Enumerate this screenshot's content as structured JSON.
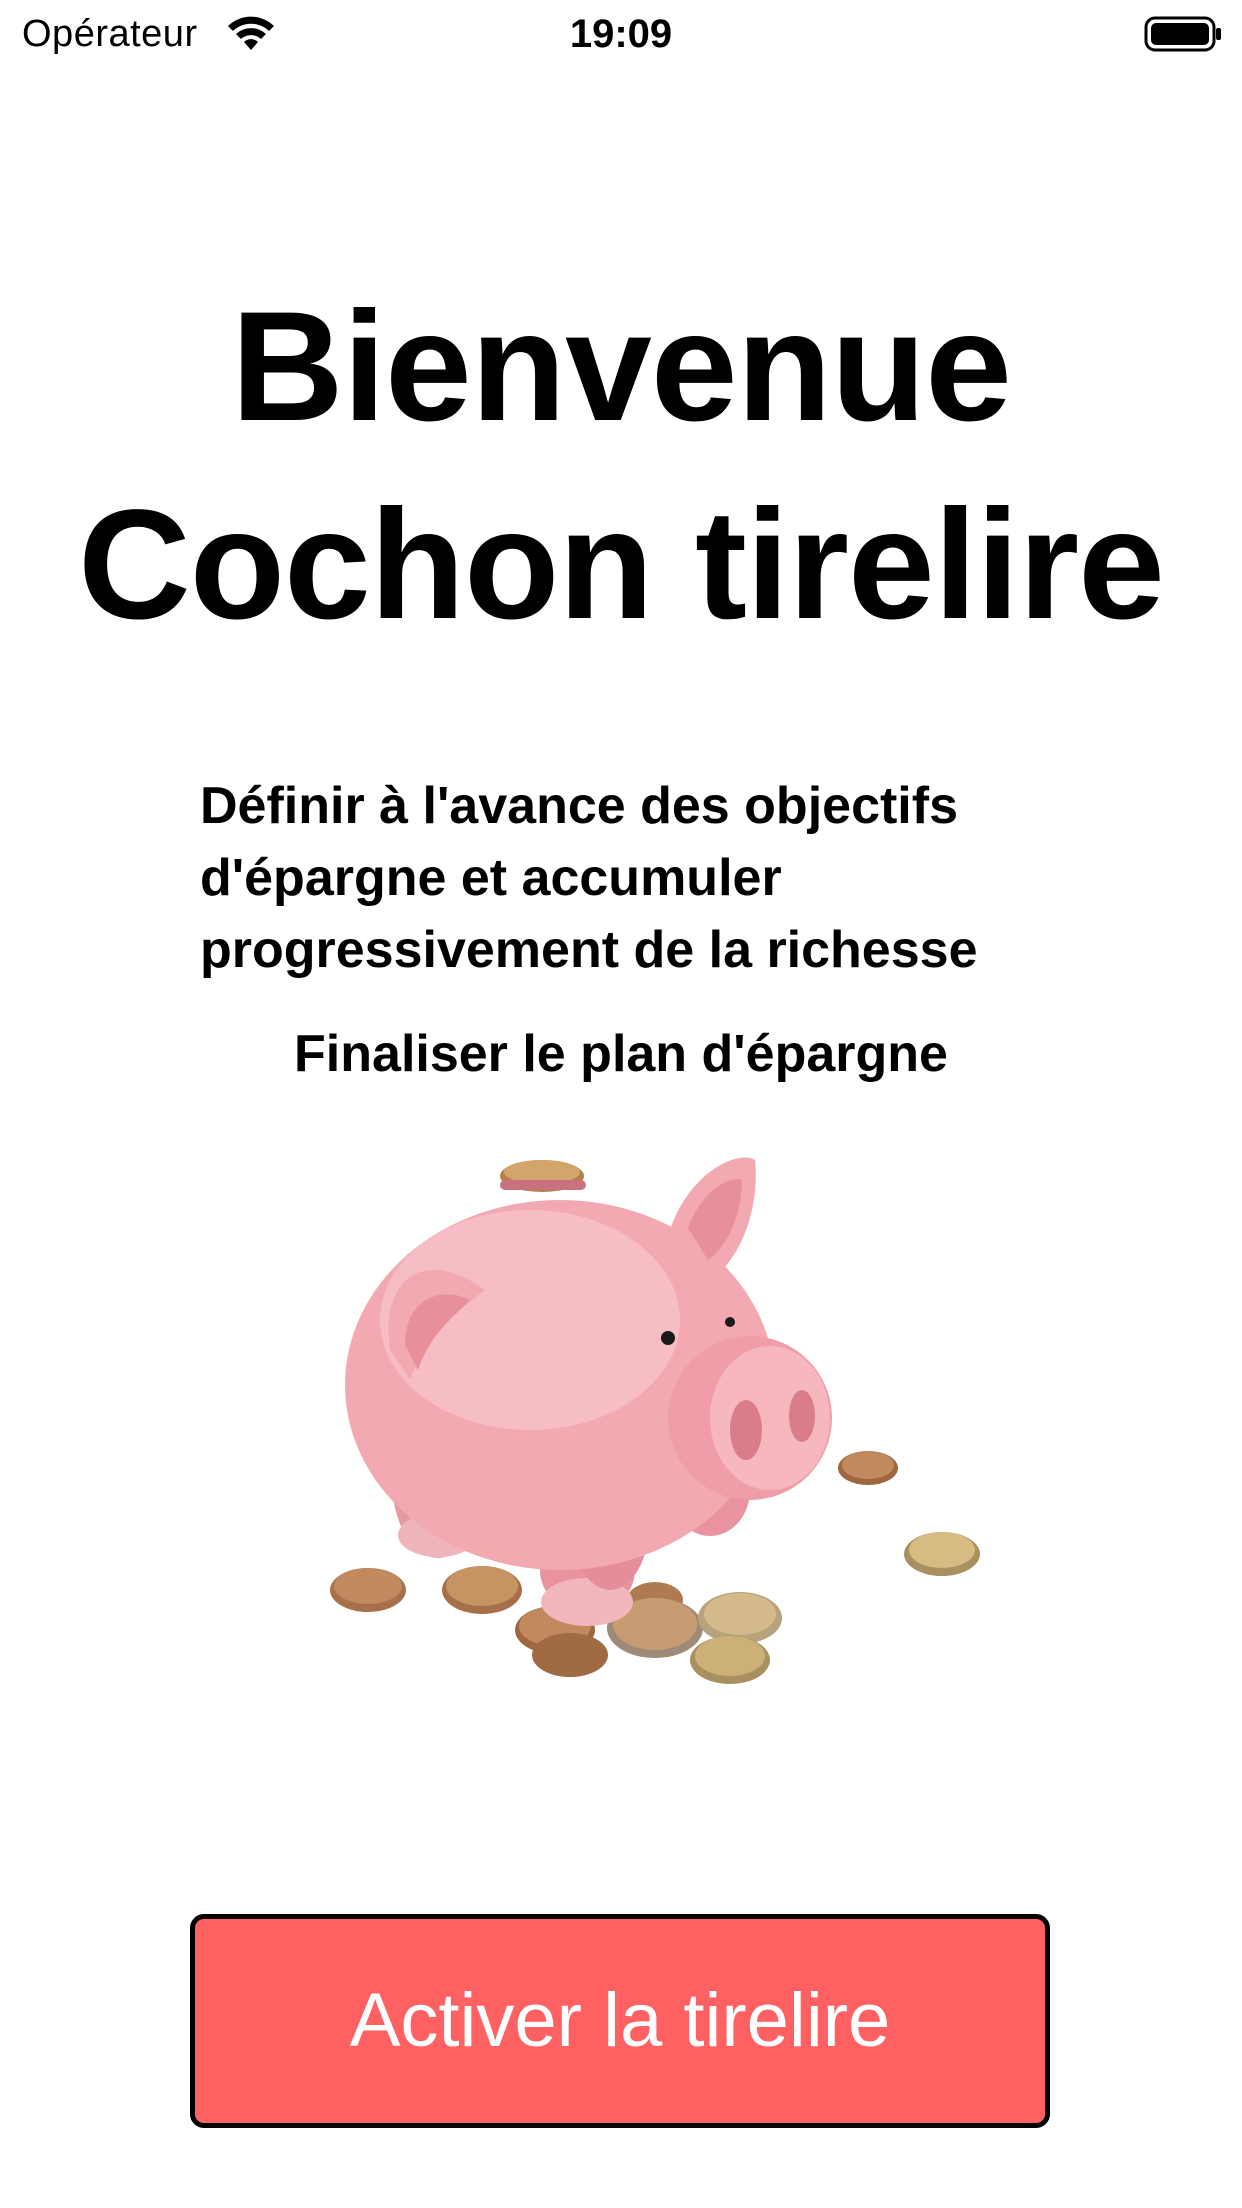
{
  "status_bar": {
    "carrier": "Opérateur",
    "time": "19:09",
    "wifi_icon": "wifi-icon",
    "battery_icon": "battery-full-icon"
  },
  "welcome": {
    "title_line1": "Bienvenue",
    "title_line2": "Cochon tirelire",
    "subtitle_line1": "Définir à l'avance des objectifs",
    "subtitle_line2": "d'épargne et accumuler",
    "subtitle_line3": "progressivement de la richesse",
    "plan_label": "Finaliser le plan d'épargne"
  },
  "illustration": {
    "icon": "piggy-bank-illustration"
  },
  "action": {
    "button_label": "Activer la tirelire",
    "button_color": "#ff6163"
  }
}
